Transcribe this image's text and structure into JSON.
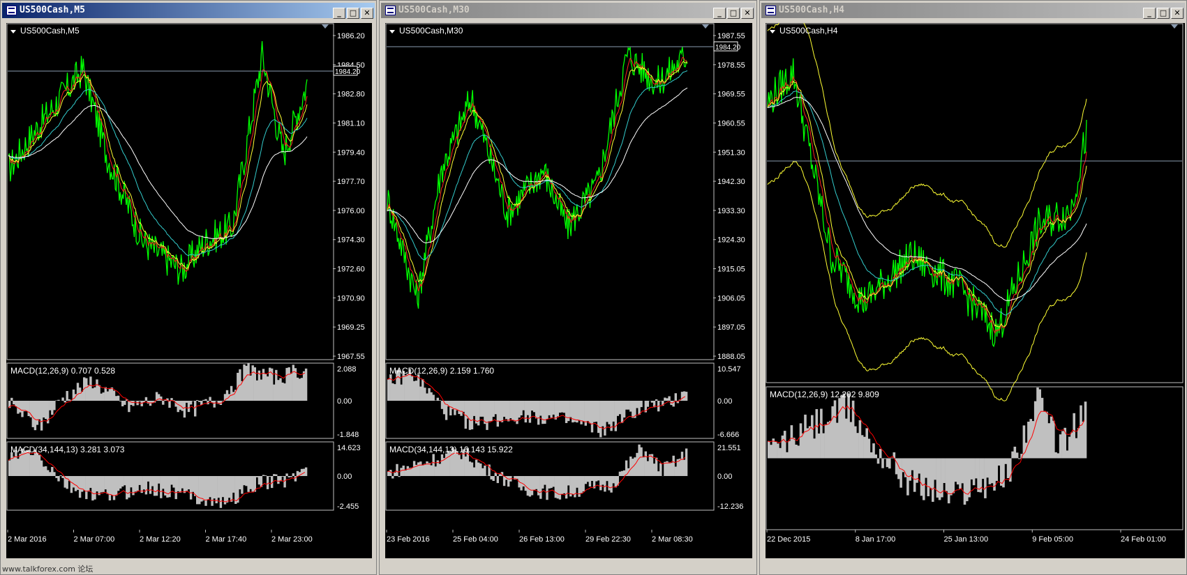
{
  "colors": {
    "bg": "#000000",
    "price": "#00ff00",
    "red_ma": "#ff2020",
    "yellow_ma": "#ffff33",
    "cyan_ma": "#33cccc",
    "white_ma": "#ffffff",
    "hist": "#c0c0c0",
    "signal": "#ff0000",
    "grid": "#c0c0c0",
    "level_line": "#8a9bb0"
  },
  "window_buttons": {
    "minimize": "_",
    "maximize": "□",
    "close": "✕"
  },
  "footer": "www.talkforex.com 论坛",
  "windows": [
    {
      "title": "US500Cash,M5",
      "label": "US500Cash,M5",
      "active": true,
      "price_ticks": [
        "1986.20",
        "1984.50",
        "1982.80",
        "1981.10",
        "1979.40",
        "1977.70",
        "1976.00",
        "1974.30",
        "1972.60",
        "1970.90",
        "1969.25",
        "1967.55"
      ],
      "current_price": "1984.20",
      "macd1": {
        "label": "MACD(12,26,9) 0.707 0.528",
        "ticks": [
          "2.088",
          "0.00",
          "-1.848"
        ]
      },
      "macd2": {
        "label": "MACD(34,144,13) 3.281 3.073",
        "ticks": [
          "14.623",
          "0.00",
          "-2.455"
        ]
      },
      "time_labels": [
        "2 Mar 2016",
        "2 Mar 07:00",
        "2 Mar 12:20",
        "2 Mar 17:40",
        "2 Mar 23:00"
      ]
    },
    {
      "title": "US500Cash,M30",
      "label": "US500Cash,M30",
      "active": false,
      "price_ticks": [
        "1987.55",
        "1978.55",
        "1969.55",
        "1960.55",
        "1951.30",
        "1942.30",
        "1933.30",
        "1924.30",
        "1915.05",
        "1906.05",
        "1897.05",
        "1888.05"
      ],
      "current_price": "1984.20",
      "macd1": {
        "label": "MACD(12,26,9) 2.159 1.760",
        "ticks": [
          "10.547",
          "0.00",
          "-6.666"
        ]
      },
      "macd2": {
        "label": "MACD(34,144,13) 16.143 15.922",
        "ticks": [
          "21.551",
          "0.00",
          "-12.236"
        ]
      },
      "time_labels": [
        "23 Feb 2016",
        "25 Feb 04:00",
        "26 Feb 13:00",
        "29 Feb 22:30",
        "2 Mar 08:30"
      ]
    },
    {
      "title": "US500Cash,H4",
      "label": "US500Cash,H4",
      "active": false,
      "price_ticks": [],
      "current_price": "",
      "macd1": {
        "label": "MACD(12,26,9) 12.202 9.809",
        "ticks": []
      },
      "macd2": null,
      "time_labels": [
        "22 Dec 2015",
        "8 Jan 17:00",
        "25 Jan 13:00",
        "9 Feb 05:00",
        "24 Feb 01:00"
      ]
    }
  ]
}
